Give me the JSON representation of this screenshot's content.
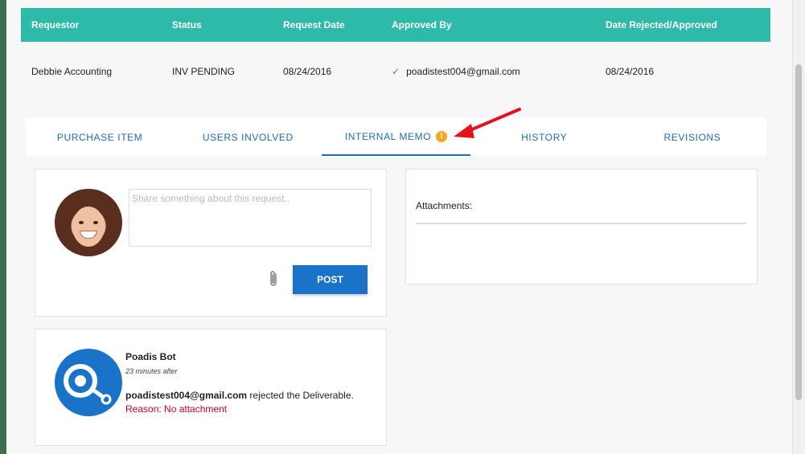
{
  "table": {
    "headers": [
      "Requestor",
      "Status",
      "Request Date",
      "Approved By",
      "Date Rejected/Approved"
    ],
    "row": {
      "requestor": "Debbie Accounting",
      "status": "INV PENDING",
      "request_date": "08/24/2016",
      "approved_by": "poadistest004@gmail.com",
      "date_rejected_approved": "08/24/2016"
    }
  },
  "tabs": [
    {
      "label": "PURCHASE ITEM"
    },
    {
      "label": "USERS INVOLVED"
    },
    {
      "label": "INTERNAL MEMO",
      "active": true,
      "badge": "!"
    },
    {
      "label": "HISTORY"
    },
    {
      "label": "REVISIONS"
    }
  ],
  "composer": {
    "placeholder": "Share something about this request..",
    "post_label": "POST"
  },
  "attachments": {
    "label": "Attachments:"
  },
  "feed": {
    "author": "Poadis Bot",
    "time": "23 minutes after",
    "actor": "poadistest004@gmail.com",
    "action": " rejected the Deliverable.",
    "reason": "Reason: No attachment"
  },
  "colors": {
    "header_teal": "#2dbaa9",
    "tab_blue": "#1f6db3",
    "post_button": "#1a73c9",
    "warning_badge": "#f5a623",
    "reason_red": "#d0021b",
    "arrow_red": "#e3121b"
  }
}
